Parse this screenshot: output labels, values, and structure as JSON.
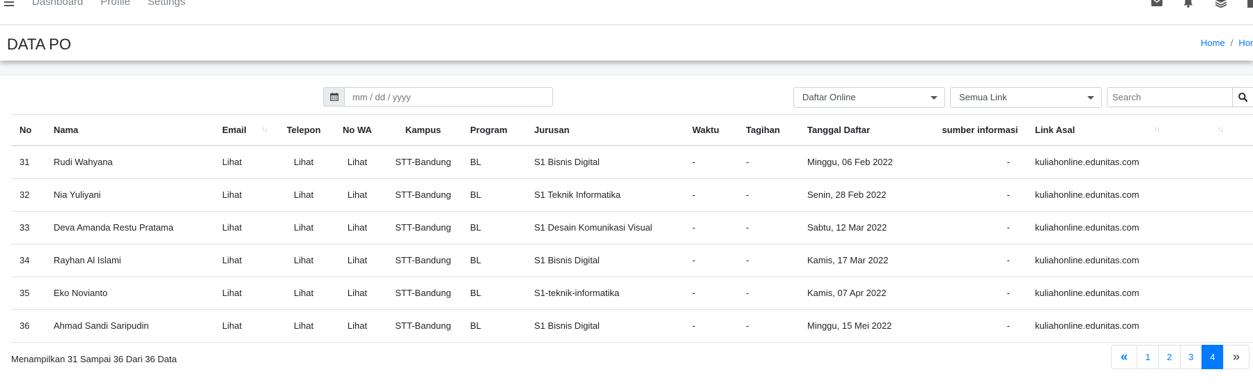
{
  "navbar": {
    "links": [
      "Dashboard",
      "Profile",
      "Settings"
    ]
  },
  "header": {
    "title": "DATA PO",
    "breadcrumb": [
      "Home",
      "Hom"
    ]
  },
  "filters": {
    "date_placeholder": "mm / dd / yyyy",
    "select_1": "Daftar Online",
    "select_2": "Semua Link",
    "search_placeholder": "Search"
  },
  "table": {
    "columns": [
      "No",
      "Nama",
      "Email",
      "Telepon",
      "No WA",
      "Kampus",
      "Program",
      "Jurusan",
      "Waktu",
      "Tagihan",
      "Tanggal Daftar",
      "sumber informasi",
      "Link Asal"
    ],
    "rows": [
      [
        "31",
        "Rudi Wahyana",
        "Lihat",
        "Lihat",
        "Lihat",
        "STT-Bandung",
        "BL",
        "S1 Bisnis Digital",
        "-",
        "-",
        "Minggu, 06 Feb 2022",
        "-",
        "kuliahonline.edunitas.com"
      ],
      [
        "32",
        "Nia Yuliyani",
        "Lihat",
        "Lihat",
        "Lihat",
        "STT-Bandung",
        "BL",
        "S1 Teknik Informatika",
        "-",
        "-",
        "Senin, 28 Feb 2022",
        "-",
        "kuliahonline.edunitas.com"
      ],
      [
        "33",
        "Deva Amanda Restu Pratama",
        "Lihat",
        "Lihat",
        "Lihat",
        "STT-Bandung",
        "BL",
        "S1 Desain Komunikasi Visual",
        "-",
        "-",
        "Sabtu, 12 Mar 2022",
        "-",
        "kuliahonline.edunitas.com"
      ],
      [
        "34",
        "Rayhan Al Islami",
        "Lihat",
        "Lihat",
        "Lihat",
        "STT-Bandung",
        "BL",
        "S1 Bisnis Digital",
        "-",
        "-",
        "Kamis, 17 Mar 2022",
        "-",
        "kuliahonline.edunitas.com"
      ],
      [
        "35",
        "Eko Novianto",
        "Lihat",
        "Lihat",
        "Lihat",
        "STT-Bandung",
        "BL",
        "S1-teknik-informatika",
        "-",
        "-",
        "Kamis, 07 Apr 2022",
        "-",
        "kuliahonline.edunitas.com"
      ],
      [
        "36",
        "Ahmad Sandi Saripudin",
        "Lihat",
        "Lihat",
        "Lihat",
        "STT-Bandung",
        "BL",
        "S1 Bisnis Digital",
        "-",
        "-",
        "Minggu, 15 Mei 2022",
        "-",
        "kuliahonline.edunitas.com"
      ]
    ]
  },
  "footer": {
    "info": "Menampilkan 31 Sampai 36 Dari 36 Data",
    "pages": [
      "1",
      "2",
      "3",
      "4"
    ],
    "active_page": "4",
    "first_symbol": "«",
    "last_symbol": "»"
  },
  "colors": {
    "accent": "#007bff"
  }
}
